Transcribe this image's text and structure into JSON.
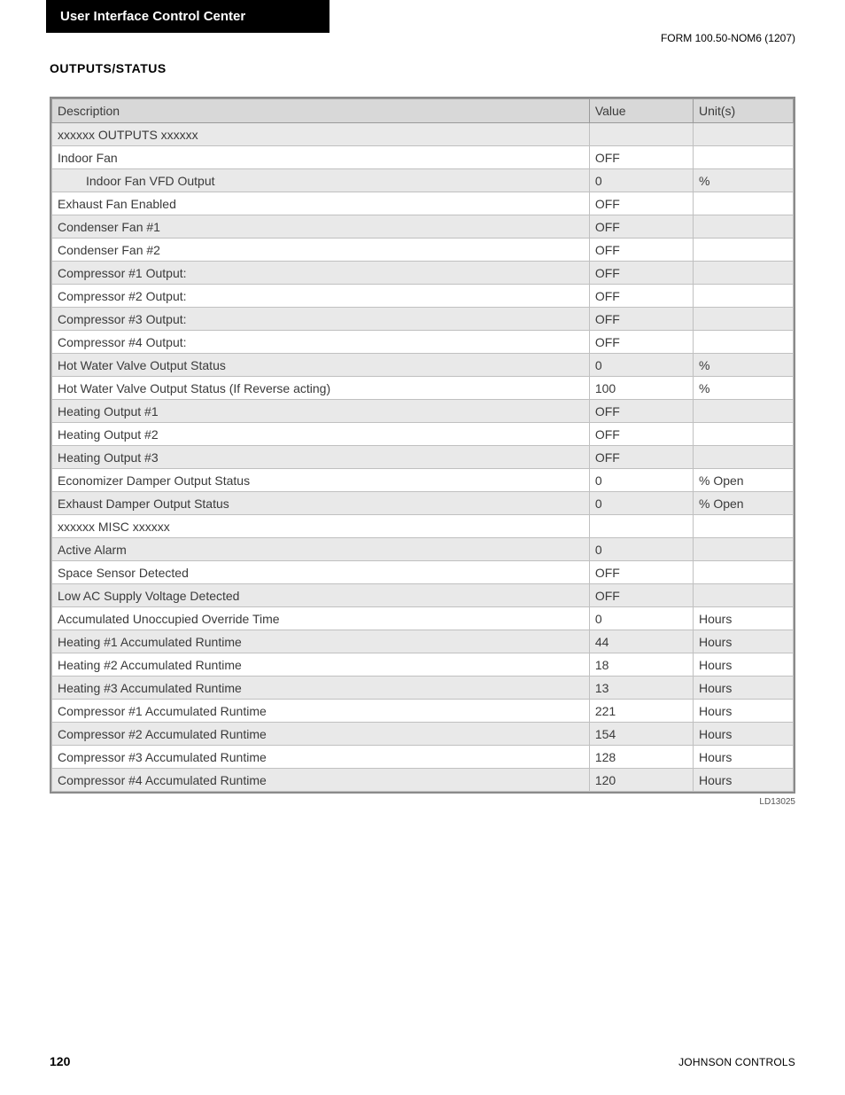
{
  "banner": "User Interface Control Center",
  "form_code": "FORM 100.50-NOM6 (1207)",
  "section_heading": "OUTPUTS/STATUS",
  "table": {
    "headers": {
      "desc": "Description",
      "value": "Value",
      "unit": "Unit(s)"
    },
    "rows": [
      {
        "desc": "xxxxxx OUTPUTS  xxxxxx",
        "value": "",
        "unit": "",
        "indent": false
      },
      {
        "desc": "Indoor Fan",
        "value": "OFF",
        "unit": "",
        "indent": false
      },
      {
        "desc": "Indoor Fan VFD Output",
        "value": "0",
        "unit": "%",
        "indent": true
      },
      {
        "desc": "Exhaust Fan Enabled",
        "value": "OFF",
        "unit": "",
        "indent": false
      },
      {
        "desc": "Condenser Fan #1",
        "value": "OFF",
        "unit": "",
        "indent": false
      },
      {
        "desc": "Condenser Fan #2",
        "value": "OFF",
        "unit": "",
        "indent": false
      },
      {
        "desc": "Compressor #1 Output:",
        "value": "OFF",
        "unit": "",
        "indent": false
      },
      {
        "desc": "Compressor #2 Output:",
        "value": "OFF",
        "unit": "",
        "indent": false
      },
      {
        "desc": "Compressor #3 Output:",
        "value": "OFF",
        "unit": "",
        "indent": false
      },
      {
        "desc": "Compressor #4 Output:",
        "value": "OFF",
        "unit": "",
        "indent": false
      },
      {
        "desc": "Hot Water Valve Output Status",
        "value": "0",
        "unit": "%",
        "indent": false
      },
      {
        "desc": "Hot Water Valve Output Status (If Reverse acting)",
        "value": "100",
        "unit": "%",
        "indent": false
      },
      {
        "desc": "Heating Output #1",
        "value": "OFF",
        "unit": "",
        "indent": false
      },
      {
        "desc": "Heating Output #2",
        "value": "OFF",
        "unit": "",
        "indent": false
      },
      {
        "desc": "Heating Output #3",
        "value": "OFF",
        "unit": "",
        "indent": false
      },
      {
        "desc": "Economizer Damper Output Status",
        "value": "0",
        "unit": "% Open",
        "indent": false
      },
      {
        "desc": "Exhaust Damper Output Status",
        "value": "0",
        "unit": "% Open",
        "indent": false
      },
      {
        "desc": "xxxxxx MISC  xxxxxx",
        "value": "",
        "unit": "",
        "indent": false
      },
      {
        "desc": "Active Alarm",
        "value": "0",
        "unit": "",
        "indent": false
      },
      {
        "desc": "Space Sensor Detected",
        "value": "OFF",
        "unit": "",
        "indent": false
      },
      {
        "desc": "Low AC Supply Voltage Detected",
        "value": "OFF",
        "unit": "",
        "indent": false
      },
      {
        "desc": "Accumulated Unoccupied Override Time",
        "value": "0",
        "unit": "Hours",
        "indent": false
      },
      {
        "desc": "Heating #1 Accumulated Runtime",
        "value": "44",
        "unit": "Hours",
        "indent": false
      },
      {
        "desc": "Heating #2 Accumulated Runtime",
        "value": "18",
        "unit": "Hours",
        "indent": false
      },
      {
        "desc": "Heating #3 Accumulated Runtime",
        "value": "13",
        "unit": "Hours",
        "indent": false
      },
      {
        "desc": "Compressor #1 Accumulated Runtime",
        "value": "221",
        "unit": "Hours",
        "indent": false
      },
      {
        "desc": "Compressor #2 Accumulated Runtime",
        "value": "154",
        "unit": "Hours",
        "indent": false
      },
      {
        "desc": "Compressor #3 Accumulated Runtime",
        "value": "128",
        "unit": "Hours",
        "indent": false
      },
      {
        "desc": "Compressor #4 Accumulated Runtime",
        "value": "120",
        "unit": "Hours",
        "indent": false
      }
    ]
  },
  "figure_id": "LD13025",
  "footer": {
    "page": "120",
    "company": "JOHNSON CONTROLS"
  }
}
